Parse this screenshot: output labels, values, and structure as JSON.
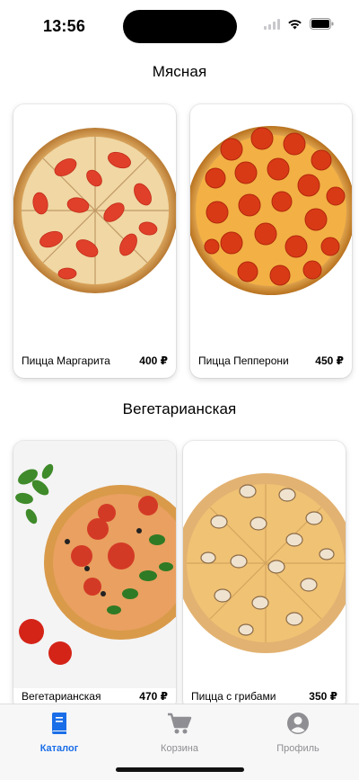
{
  "status": {
    "time": "13:56"
  },
  "sections": [
    {
      "title": "Мясная",
      "items": [
        {
          "name": "Пицца Маргарита",
          "price": "400 ₽"
        },
        {
          "name": "Пицца Пепперони",
          "price": "450 ₽"
        }
      ]
    },
    {
      "title": "Вегетарианская",
      "items": [
        {
          "name": "Вегетарианская",
          "price": "470 ₽"
        },
        {
          "name": "Пицца с грибами",
          "price": "350 ₽"
        }
      ]
    }
  ],
  "tabbar": {
    "active_color": "#1a6ee8",
    "inactive_color": "#8e8e93",
    "tabs": [
      {
        "label": "Каталог",
        "icon": "catalog-book-icon",
        "active": true
      },
      {
        "label": "Корзина",
        "icon": "cart-icon",
        "active": false
      },
      {
        "label": "Профиль",
        "icon": "profile-person-icon",
        "active": false
      }
    ]
  }
}
